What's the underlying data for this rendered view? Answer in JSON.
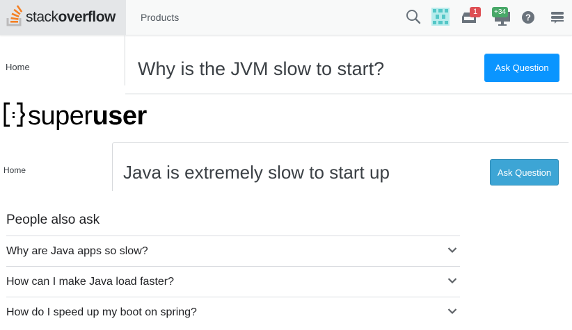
{
  "stackoverflow": {
    "logo_light": "stack",
    "logo_bold": "overflow",
    "nav_products": "Products",
    "inbox_count": "1",
    "achievements_count": "+34",
    "breadcrumb_home": "Home",
    "question_title": "Why is the JVM slow to start?",
    "ask_button": "Ask Question",
    "colors": {
      "accent": "#0a95ff",
      "logo_orange": "#f48024",
      "inbox_badge": "#de4f54",
      "achievement_badge": "#48a868"
    },
    "icons": [
      "stackoverflow-logo-icon",
      "search-icon",
      "user-avatar",
      "inbox-icon",
      "achievements-icon",
      "help-icon",
      "site-switcher-icon"
    ]
  },
  "superuser": {
    "logo_light": "super",
    "logo_bold": "user",
    "breadcrumb_home": "Home",
    "question_title": "Java is extremely slow to start up",
    "ask_button": "Ask Question",
    "colors": {
      "accent": "#3da5d5"
    }
  },
  "people_also_ask": {
    "title": "People also ask",
    "questions": [
      "Why are Java apps so slow?",
      "How can I make Java load faster?",
      "How do I speed up my boot on spring?"
    ]
  }
}
